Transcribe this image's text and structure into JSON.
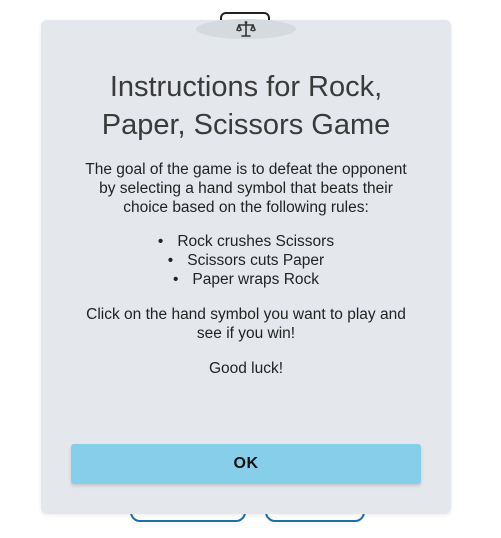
{
  "modal": {
    "icon": "balance-scale-icon",
    "title_line1": "Instructions for Rock,",
    "title_line2": "Paper, Scissors Game",
    "intro": "The goal of the game is to defeat the opponent by selecting a hand symbol that beats their choice based on the following rules:",
    "rules": [
      "Rock crushes Scissors",
      "Scissors cuts Paper",
      "Paper wraps Rock"
    ],
    "cta": "Click on the hand symbol you want to play and see if you win!",
    "luck": "Good luck!",
    "ok_label": "OK"
  },
  "colors": {
    "modal_bg": "#e4e8ec",
    "ok_button": "#87ceeb",
    "background_button_border": "#1e6fa8"
  }
}
